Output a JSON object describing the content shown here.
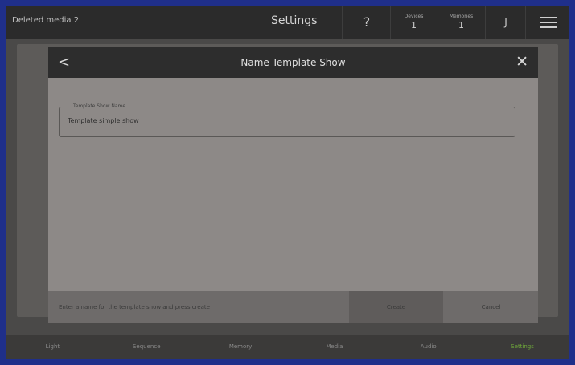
{
  "topbar": {
    "show_name": "Deleted media 2",
    "title": "Settings",
    "help_label": "?",
    "devices": {
      "label": "Devices",
      "count": "1"
    },
    "memories": {
      "label": "Memories",
      "count": "1"
    },
    "user_initial": "J"
  },
  "modal": {
    "back_label": "<",
    "title": "Name Template Show",
    "close_label": "✕",
    "field": {
      "label": "Template Show Name",
      "value": "Template simple show"
    },
    "hint": "Enter a name for the template show and press create",
    "create_label": "Create",
    "cancel_label": "Cancel"
  },
  "bottom_nav": {
    "light": "Light",
    "sequence": "Sequence",
    "memory": "Memory",
    "media": "Media",
    "audio": "Audio",
    "settings": "Settings"
  },
  "colors": {
    "active_tab": "#6fa93a",
    "modal_bg": "#8d8987",
    "header_bg": "#2d2d2d"
  }
}
